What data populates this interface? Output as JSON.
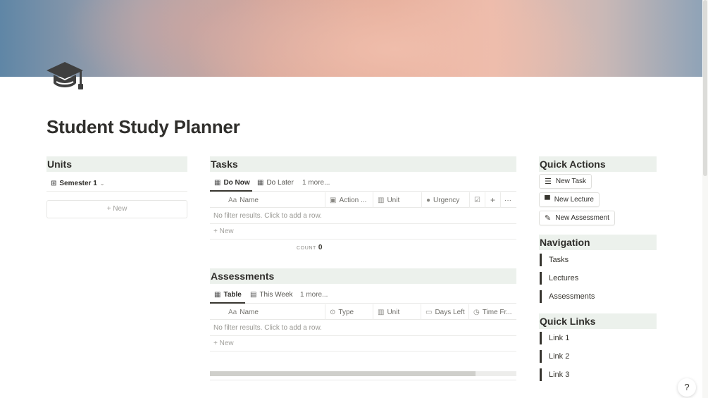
{
  "page": {
    "title": "Student Study Planner",
    "icon": "graduation-cap-icon"
  },
  "units": {
    "heading": "Units",
    "view_label": "Semester 1",
    "new_label": "+ New"
  },
  "tasks": {
    "heading": "Tasks",
    "tabs": [
      "Do Now",
      "Do Later"
    ],
    "more_label": "1 more...",
    "columns": [
      {
        "icon_text": "Aa",
        "label": "Name"
      },
      {
        "icon_text": "▣",
        "label": "Action ..."
      },
      {
        "icon_text": "▥",
        "label": "Unit"
      },
      {
        "icon_text": "●",
        "label": "Urgency"
      },
      {
        "icon_text": "☑",
        "label": ""
      }
    ],
    "add_column": "+",
    "more_options": "···",
    "empty_text": "No filter results. Click to add a row.",
    "new_label": "+ New",
    "count_label": "COUNT",
    "count_value": "0"
  },
  "assessments": {
    "heading": "Assessments",
    "tabs": [
      "Table",
      "This Week"
    ],
    "more_label": "1 more...",
    "columns": [
      {
        "icon_text": "Aa",
        "label": "Name"
      },
      {
        "icon_text": "⊙",
        "label": "Type"
      },
      {
        "icon_text": "▥",
        "label": "Unit"
      },
      {
        "icon_text": "▭",
        "label": "Days Left"
      },
      {
        "icon_text": "◷",
        "label": "Time Fr..."
      }
    ],
    "empty_text": "No filter results. Click to add a row.",
    "new_label": "+ New"
  },
  "quick_actions": {
    "heading": "Quick Actions",
    "buttons": [
      {
        "icon_text": "☰",
        "label": "New Task"
      },
      {
        "icon_text": "▀",
        "label": "New Lecture"
      },
      {
        "icon_text": "✎",
        "label": "New Assessment"
      }
    ]
  },
  "navigation": {
    "heading": "Navigation",
    "items": [
      "Tasks",
      "Lectures",
      "Assessments"
    ]
  },
  "quick_links": {
    "heading": "Quick Links",
    "items": [
      "Link 1",
      "Link 2",
      "Link 3"
    ]
  },
  "help": {
    "label": "?"
  },
  "colors": {
    "heading_bg": "#ecf1ec",
    "text": "#37352f"
  }
}
